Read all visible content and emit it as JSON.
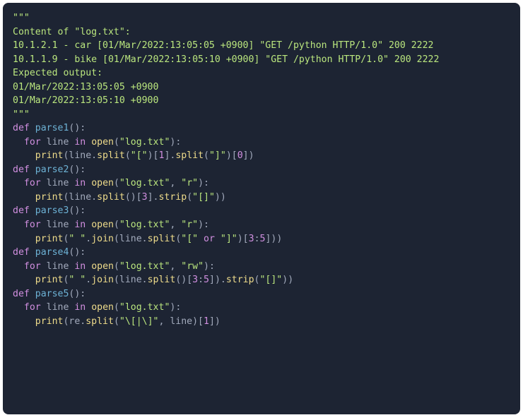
{
  "code": {
    "lines": [
      [
        [
          "str",
          "\"\"\""
        ]
      ],
      [
        [
          "str",
          "Content of \"log.txt\":"
        ]
      ],
      [
        [
          "str",
          "10.1.2.1 - car [01/Mar/2022:13:05:05 +0900] \"GET /python HTTP/1.0\" 200 2222"
        ]
      ],
      [
        [
          "str",
          "10.1.1.9 - bike [01/Mar/2022:13:05:10 +0900] \"GET /python HTTP/1.0\" 200 2222"
        ]
      ],
      [
        [
          "str",
          ""
        ]
      ],
      [
        [
          "str",
          "Expected output:"
        ]
      ],
      [
        [
          "str",
          "01/Mar/2022:13:05:05 +0900"
        ]
      ],
      [
        [
          "str",
          "01/Mar/2022:13:05:10 +0900"
        ]
      ],
      [
        [
          "str",
          "\"\"\""
        ]
      ],
      [
        [
          "ident",
          ""
        ]
      ],
      [
        [
          "kw",
          "def"
        ],
        [
          "ident",
          " "
        ],
        [
          "fnname",
          "parse1"
        ],
        [
          "punc",
          "():"
        ]
      ],
      [
        [
          "ident",
          "  "
        ],
        [
          "kw",
          "for"
        ],
        [
          "ident",
          " line "
        ],
        [
          "kw",
          "in"
        ],
        [
          "ident",
          " "
        ],
        [
          "call",
          "open"
        ],
        [
          "punc",
          "("
        ],
        [
          "str",
          "\"log.txt\""
        ],
        [
          "punc",
          "):"
        ]
      ],
      [
        [
          "ident",
          "    "
        ],
        [
          "call",
          "print"
        ],
        [
          "punc",
          "(line."
        ],
        [
          "method",
          "split"
        ],
        [
          "punc",
          "("
        ],
        [
          "str",
          "\"[\""
        ],
        [
          "punc",
          ")["
        ],
        [
          "num",
          "1"
        ],
        [
          "punc",
          "]."
        ],
        [
          "method",
          "split"
        ],
        [
          "punc",
          "("
        ],
        [
          "str",
          "\"]\""
        ],
        [
          "punc",
          ")["
        ],
        [
          "num",
          "0"
        ],
        [
          "punc",
          "])"
        ]
      ],
      [
        [
          "ident",
          ""
        ]
      ],
      [
        [
          "kw",
          "def"
        ],
        [
          "ident",
          " "
        ],
        [
          "fnname",
          "parse2"
        ],
        [
          "punc",
          "():"
        ]
      ],
      [
        [
          "ident",
          "  "
        ],
        [
          "kw",
          "for"
        ],
        [
          "ident",
          " line "
        ],
        [
          "kw",
          "in"
        ],
        [
          "ident",
          " "
        ],
        [
          "call",
          "open"
        ],
        [
          "punc",
          "("
        ],
        [
          "str",
          "\"log.txt\""
        ],
        [
          "punc",
          ", "
        ],
        [
          "str",
          "\"r\""
        ],
        [
          "punc",
          "):"
        ]
      ],
      [
        [
          "ident",
          "    "
        ],
        [
          "call",
          "print"
        ],
        [
          "punc",
          "(line."
        ],
        [
          "method",
          "split"
        ],
        [
          "punc",
          "()["
        ],
        [
          "num",
          "3"
        ],
        [
          "punc",
          "]."
        ],
        [
          "method",
          "strip"
        ],
        [
          "punc",
          "("
        ],
        [
          "str",
          "\"[]\""
        ],
        [
          "punc",
          "))"
        ]
      ],
      [
        [
          "ident",
          ""
        ]
      ],
      [
        [
          "kw",
          "def"
        ],
        [
          "ident",
          " "
        ],
        [
          "fnname",
          "parse3"
        ],
        [
          "punc",
          "():"
        ]
      ],
      [
        [
          "ident",
          "  "
        ],
        [
          "kw",
          "for"
        ],
        [
          "ident",
          " line "
        ],
        [
          "kw",
          "in"
        ],
        [
          "ident",
          " "
        ],
        [
          "call",
          "open"
        ],
        [
          "punc",
          "("
        ],
        [
          "str",
          "\"log.txt\""
        ],
        [
          "punc",
          ", "
        ],
        [
          "str",
          "\"r\""
        ],
        [
          "punc",
          "):"
        ]
      ],
      [
        [
          "ident",
          "    "
        ],
        [
          "call",
          "print"
        ],
        [
          "punc",
          "("
        ],
        [
          "str",
          "\" \""
        ],
        [
          "punc",
          "."
        ],
        [
          "method",
          "join"
        ],
        [
          "punc",
          "(line."
        ],
        [
          "method",
          "split"
        ],
        [
          "punc",
          "("
        ],
        [
          "str",
          "\"[\""
        ],
        [
          "ident",
          " "
        ],
        [
          "kw",
          "or"
        ],
        [
          "ident",
          " "
        ],
        [
          "str",
          "\"]\""
        ],
        [
          "punc",
          ")["
        ],
        [
          "num",
          "3"
        ],
        [
          "punc",
          ":"
        ],
        [
          "num",
          "5"
        ],
        [
          "punc",
          "]))"
        ]
      ],
      [
        [
          "ident",
          ""
        ]
      ],
      [
        [
          "kw",
          "def"
        ],
        [
          "ident",
          " "
        ],
        [
          "fnname",
          "parse4"
        ],
        [
          "punc",
          "():"
        ]
      ],
      [
        [
          "ident",
          "  "
        ],
        [
          "kw",
          "for"
        ],
        [
          "ident",
          " line "
        ],
        [
          "kw",
          "in"
        ],
        [
          "ident",
          " "
        ],
        [
          "call",
          "open"
        ],
        [
          "punc",
          "("
        ],
        [
          "str",
          "\"log.txt\""
        ],
        [
          "punc",
          ", "
        ],
        [
          "str",
          "\"rw\""
        ],
        [
          "punc",
          "):"
        ]
      ],
      [
        [
          "ident",
          "    "
        ],
        [
          "call",
          "print"
        ],
        [
          "punc",
          "("
        ],
        [
          "str",
          "\" \""
        ],
        [
          "punc",
          "."
        ],
        [
          "method",
          "join"
        ],
        [
          "punc",
          "(line."
        ],
        [
          "method",
          "split"
        ],
        [
          "punc",
          "()["
        ],
        [
          "num",
          "3"
        ],
        [
          "punc",
          ":"
        ],
        [
          "num",
          "5"
        ],
        [
          "punc",
          "])."
        ],
        [
          "method",
          "strip"
        ],
        [
          "punc",
          "("
        ],
        [
          "str",
          "\"[]\""
        ],
        [
          "punc",
          "))"
        ]
      ],
      [
        [
          "ident",
          ""
        ]
      ],
      [
        [
          "kw",
          "def"
        ],
        [
          "ident",
          " "
        ],
        [
          "fnname",
          "parse5"
        ],
        [
          "punc",
          "():"
        ]
      ],
      [
        [
          "ident",
          "  "
        ],
        [
          "kw",
          "for"
        ],
        [
          "ident",
          " line "
        ],
        [
          "kw",
          "in"
        ],
        [
          "ident",
          " "
        ],
        [
          "call",
          "open"
        ],
        [
          "punc",
          "("
        ],
        [
          "str",
          "\"log.txt\""
        ],
        [
          "punc",
          "):"
        ]
      ],
      [
        [
          "ident",
          "    "
        ],
        [
          "call",
          "print"
        ],
        [
          "punc",
          "(re."
        ],
        [
          "method",
          "split"
        ],
        [
          "punc",
          "("
        ],
        [
          "str",
          "\"\\[|\\]\""
        ],
        [
          "punc",
          ", line)["
        ],
        [
          "num",
          "1"
        ],
        [
          "punc",
          "])"
        ]
      ]
    ]
  }
}
